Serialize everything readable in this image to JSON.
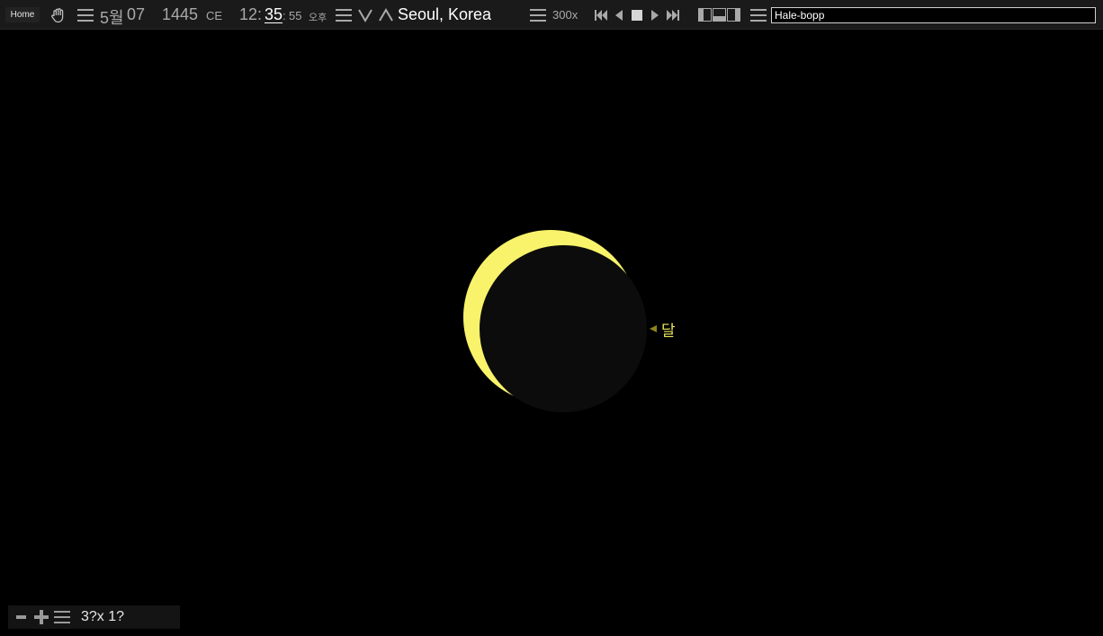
{
  "toolbar": {
    "home_label": "Home",
    "date": {
      "month": "5월",
      "day": "07",
      "year": "1445",
      "era": "CE"
    },
    "time": {
      "hour": "12:",
      "minute": "35",
      "separator": ":",
      "second": "55",
      "ampm": "오후"
    },
    "location": "Seoul, Korea",
    "speed": "300x",
    "search": {
      "value": "Hale-bopp"
    },
    "icons": {
      "pan": "hand-icon",
      "menu": "hamburger-icon",
      "down": "chevron-down-icon",
      "up": "chevron-up-icon",
      "skip_start": "skip-start-icon",
      "step_back": "step-back-icon",
      "stop": "stop-icon",
      "play": "play-icon",
      "skip_end": "skip-end-icon",
      "layout": "panel-layout-icon"
    }
  },
  "sky": {
    "body_label": "달",
    "colors": {
      "sun": "#f8f36a",
      "moon": "#0c0c0c",
      "label": "#e8e35a",
      "marker": "#8a8420"
    }
  },
  "zoom": {
    "label": "3?x 1?",
    "icons": {
      "zoom_out": "minus-icon",
      "zoom_in": "plus-icon",
      "menu": "hamburger-icon"
    }
  }
}
